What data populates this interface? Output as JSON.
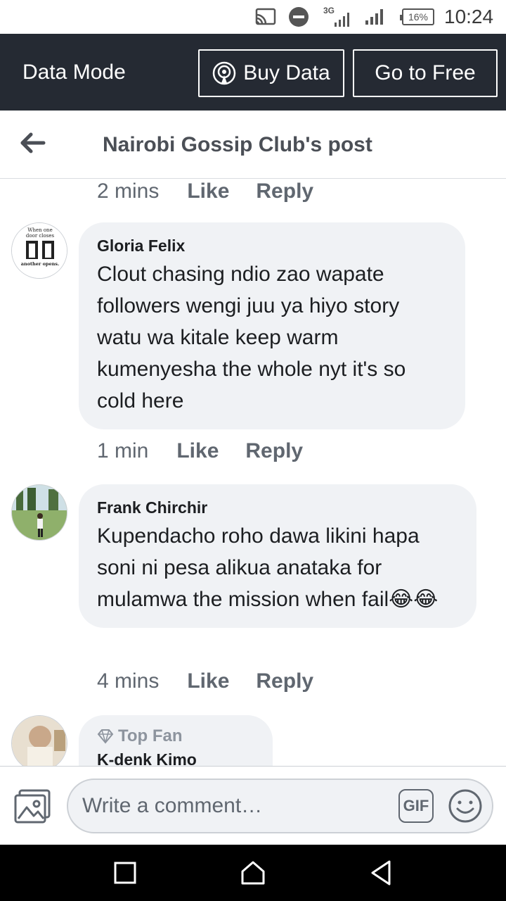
{
  "status_bar": {
    "network": "3G",
    "battery": "16%",
    "time": "10:24"
  },
  "data_bar": {
    "title": "Data Mode",
    "buy_data_label": "Buy Data",
    "go_free_label": "Go to Free"
  },
  "header": {
    "title": "Nairobi Gossip Club's post"
  },
  "comments": [
    {
      "time": "2 mins",
      "like": "Like",
      "reply": "Reply"
    },
    {
      "author": "Gloria Felix",
      "avatar_text": [
        "When one",
        "door closes",
        "another opens."
      ],
      "text": "Clout chasing ndio zao wapate followers wengi juu ya hiyo story watu wa kitale keep warm kumenyesha the whole nyt it's so cold here",
      "time": "1 min",
      "like": "Like",
      "reply": "Reply"
    },
    {
      "author": "Frank Chirchir",
      "text": "Kupendacho roho dawa likini hapa soni ni pesa alikua anataka for mulamwa the mission when fail😂😂",
      "time": "4 mins",
      "like": "Like",
      "reply": "Reply"
    },
    {
      "badge": "Top Fan",
      "author": "K-denk Kimo"
    }
  ],
  "composer": {
    "placeholder": "Write a comment…",
    "gif_label": "GIF"
  },
  "colors": {
    "data_bar_bg": "#252a33",
    "bubble_bg": "#f0f2f5",
    "meta_text": "#606770"
  }
}
